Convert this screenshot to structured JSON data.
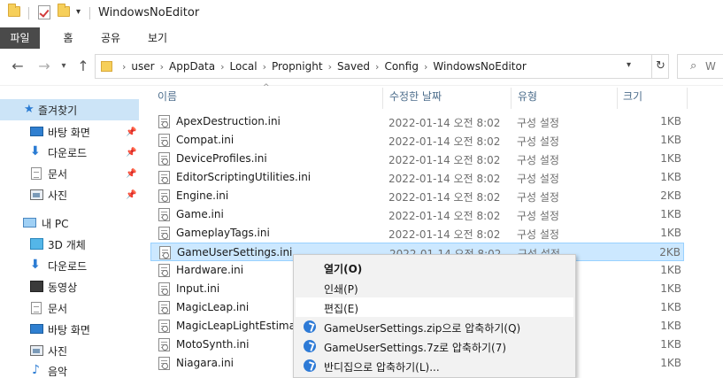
{
  "window": {
    "title": "WindowsNoEditor"
  },
  "ribbon": {
    "tabs": [
      "파일",
      "홈",
      "공유",
      "보기"
    ]
  },
  "address": {
    "crumbs": [
      "user",
      "AppData",
      "Local",
      "Propnight",
      "Saved",
      "Config",
      "WindowsNoEditor"
    ],
    "search_placeholder": "W"
  },
  "nav": {
    "items": [
      {
        "label": "즐겨찾기",
        "icon": "star-icon",
        "selected": true
      },
      {
        "label": "바탕 화면",
        "icon": "desktop-icon",
        "pinned": true
      },
      {
        "label": "다운로드",
        "icon": "download-icon",
        "pinned": true
      },
      {
        "label": "문서",
        "icon": "document-icon",
        "pinned": true
      },
      {
        "label": "사진",
        "icon": "picture-icon",
        "pinned": true
      },
      {
        "label": "내 PC",
        "icon": "pc-icon"
      },
      {
        "label": "3D 개체",
        "icon": "3d-objects-icon"
      },
      {
        "label": "다운로드",
        "icon": "download-icon"
      },
      {
        "label": "동영상",
        "icon": "video-icon"
      },
      {
        "label": "문서",
        "icon": "document-icon"
      },
      {
        "label": "바탕 화면",
        "icon": "desktop-icon"
      },
      {
        "label": "사진",
        "icon": "picture-icon"
      },
      {
        "label": "음악",
        "icon": "music-icon"
      }
    ]
  },
  "columns": {
    "name": "이름",
    "date": "수정한 날짜",
    "type": "유형",
    "size": "크기"
  },
  "files": [
    {
      "name": "ApexDestruction.ini",
      "date": "2022-01-14 오전 8:02",
      "type": "구성 설정",
      "size": "1KB"
    },
    {
      "name": "Compat.ini",
      "date": "2022-01-14 오전 8:02",
      "type": "구성 설정",
      "size": "1KB"
    },
    {
      "name": "DeviceProfiles.ini",
      "date": "2022-01-14 오전 8:02",
      "type": "구성 설정",
      "size": "1KB"
    },
    {
      "name": "EditorScriptingUtilities.ini",
      "date": "2022-01-14 오전 8:02",
      "type": "구성 설정",
      "size": "1KB"
    },
    {
      "name": "Engine.ini",
      "date": "2022-01-14 오전 8:02",
      "type": "구성 설정",
      "size": "2KB"
    },
    {
      "name": "Game.ini",
      "date": "2022-01-14 오전 8:02",
      "type": "구성 설정",
      "size": "1KB"
    },
    {
      "name": "GameplayTags.ini",
      "date": "2022-01-14 오전 8:02",
      "type": "구성 설정",
      "size": "1KB"
    },
    {
      "name": "GameUserSettings.ini",
      "date": "2022-01-14 오전 8:02",
      "type": "구성 설정",
      "size": "2KB",
      "selected": true
    },
    {
      "name": "Hardware.ini",
      "date": "",
      "type": "",
      "size": "1KB"
    },
    {
      "name": "Input.ini",
      "date": "",
      "type": "",
      "size": "1KB"
    },
    {
      "name": "MagicLeap.ini",
      "date": "",
      "type": "",
      "size": "1KB"
    },
    {
      "name": "MagicLeapLightEstimatio",
      "date": "",
      "type": "",
      "size": "1KB"
    },
    {
      "name": "MotoSynth.ini",
      "date": "",
      "type": "",
      "size": "1KB"
    },
    {
      "name": "Niagara.ini",
      "date": "",
      "type": "",
      "size": "1KB"
    }
  ],
  "context_menu": {
    "items": [
      {
        "label": "열기(O)",
        "bold": true,
        "icon": ""
      },
      {
        "label": "인쇄(P)",
        "icon": ""
      },
      {
        "label": "편집(E)",
        "icon": "",
        "hover": true
      },
      {
        "label": "GameUserSettings.zip으로 압축하기(Q)",
        "icon": "bandizip-icon"
      },
      {
        "label": "GameUserSettings.7z로 압축하기(7)",
        "icon": "bandizip-icon"
      },
      {
        "label": "반디집으로 압축하기(L)...",
        "icon": "bandizip-icon"
      }
    ]
  }
}
